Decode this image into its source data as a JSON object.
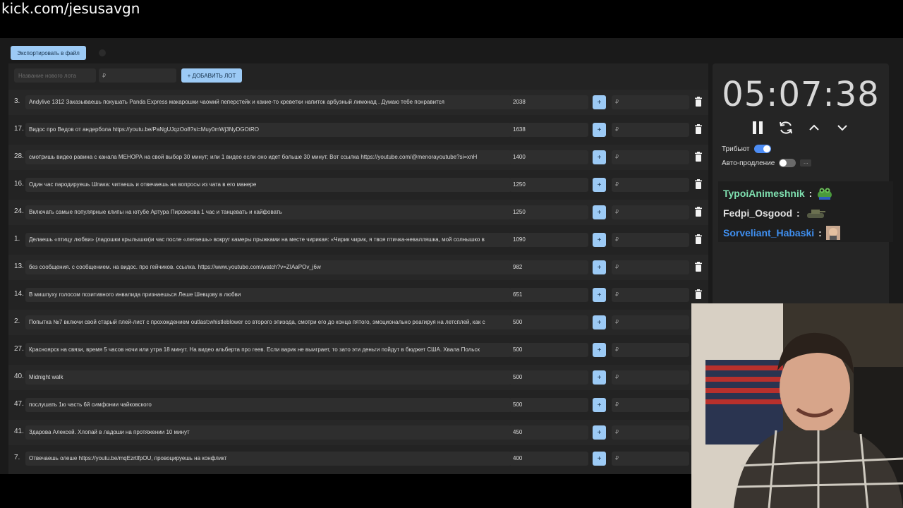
{
  "url": "kick.com/jesusavgn",
  "toolbar": {
    "export_label": "Экспортировать в файл"
  },
  "new_lot": {
    "name_placeholder": "Название нового лота",
    "amount_placeholder": "₽",
    "add_label": "+ ДОБАВИТЬ ЛОТ"
  },
  "lots": [
    {
      "num": "3.",
      "title": "Andylive 1312 Заказываешь покушать Panda Express макарошки чаомий пеперстейк и какие-то креветки напиток арбузный лимонад . Думаю тебе понравится",
      "amount": "2038",
      "add_placeholder": "₽"
    },
    {
      "num": "17.",
      "title": "Видос про Ведов от андербола https://youtu.be/PaNgUJqzOo8?si=Muy0mWj3NyDGOtRO",
      "amount": "1638",
      "add_placeholder": "₽"
    },
    {
      "num": "28.",
      "title": "смотришь видео равина с канала МЕНОРА на свой выбор 30 минут; или 1 видео если оно идет больше 30 минут. Вот ссылка https://youtube.com/@menorayoutube?si=xnH",
      "amount": "1400",
      "add_placeholder": "₽"
    },
    {
      "num": "16.",
      "title": "Один час пародируешь Шпака: читаешь и отвечаешь на вопросы из чата в его манере",
      "amount": "1250",
      "add_placeholder": "₽"
    },
    {
      "num": "24.",
      "title": "Включать самые популярные клипы на ютубе Артура Пирожкова 1 час и танцевать и кайфовать",
      "amount": "1250",
      "add_placeholder": "₽"
    },
    {
      "num": "1.",
      "title": "Делаешь «птицу любви» (ладошки крылышки)и час после «летаешь» вокруг камеры прыжками на месте чирикая: «Чирик чирик, я твоя птичка-невалляшка, мой солнышко в",
      "amount": "1090",
      "add_placeholder": "₽"
    },
    {
      "num": "13.",
      "title": "без сообщения. с сообщением. на видос. про гейчиков. ссылка. https://www.youtube.com/watch?v=ZIAaPOv_j6w",
      "amount": "982",
      "add_placeholder": "₽"
    },
    {
      "num": "14.",
      "title": "В мишпуху голосом позитивного инвалида признаешься Леше Шевцову в любви",
      "amount": "651",
      "add_placeholder": "₽"
    },
    {
      "num": "2.",
      "title": "Попытка №7 включи свой старый плей-лист с прохождением outlast:whistleblower со второго эпизода, смотри его до конца пятого, эмоционально реагируя на летсплей, как с",
      "amount": "500",
      "add_placeholder": "₽"
    },
    {
      "num": "27.",
      "title": "Красноярск на связи, время 5 часов ночи или утра 18 минут. На видео альберта про геев. Если варик не выиграет, то зато эти деньги пойдут в бюджет США. Хвала Польск",
      "amount": "500",
      "add_placeholder": "₽"
    },
    {
      "num": "40.",
      "title": "Midnight walk",
      "amount": "500",
      "add_placeholder": "₽"
    },
    {
      "num": "47.",
      "title": "послушать 1ю часть 6й симфонии чайковского",
      "amount": "500",
      "add_placeholder": "₽"
    },
    {
      "num": "41.",
      "title": "Здарова Алексей. Хлопай в ладоши на протяжении 10 минут",
      "amount": "450",
      "add_placeholder": "₽"
    },
    {
      "num": "7.",
      "title": "Отвечаешь олеше https://youtu.be/mqEzrtlfpOU, провоцируешь на конфликт",
      "amount": "400",
      "add_placeholder": "₽"
    }
  ],
  "timer": {
    "display": "05:07:38"
  },
  "settings": {
    "tribute_label": "Трибьют",
    "tribute_on": true,
    "auto_extend_label": "Авто-продление",
    "auto_extend_on": false,
    "more_label": "..."
  },
  "chat": [
    {
      "user": "TypoiAnimeshnik",
      "color": "#7fe0b0",
      "sep": ":",
      "emote": "frog-emote"
    },
    {
      "user": "Fedpi_Osgood",
      "color": "#e0e0e0",
      "sep": ":",
      "emote": "tank-emote"
    },
    {
      "user": "Sorveliant_Habaski",
      "color": "#3f8ff0",
      "sep": ":",
      "emote": "face-emote"
    }
  ],
  "colors": {
    "accent": "#9ccaf5",
    "toggle_on": "#4d8df5"
  }
}
